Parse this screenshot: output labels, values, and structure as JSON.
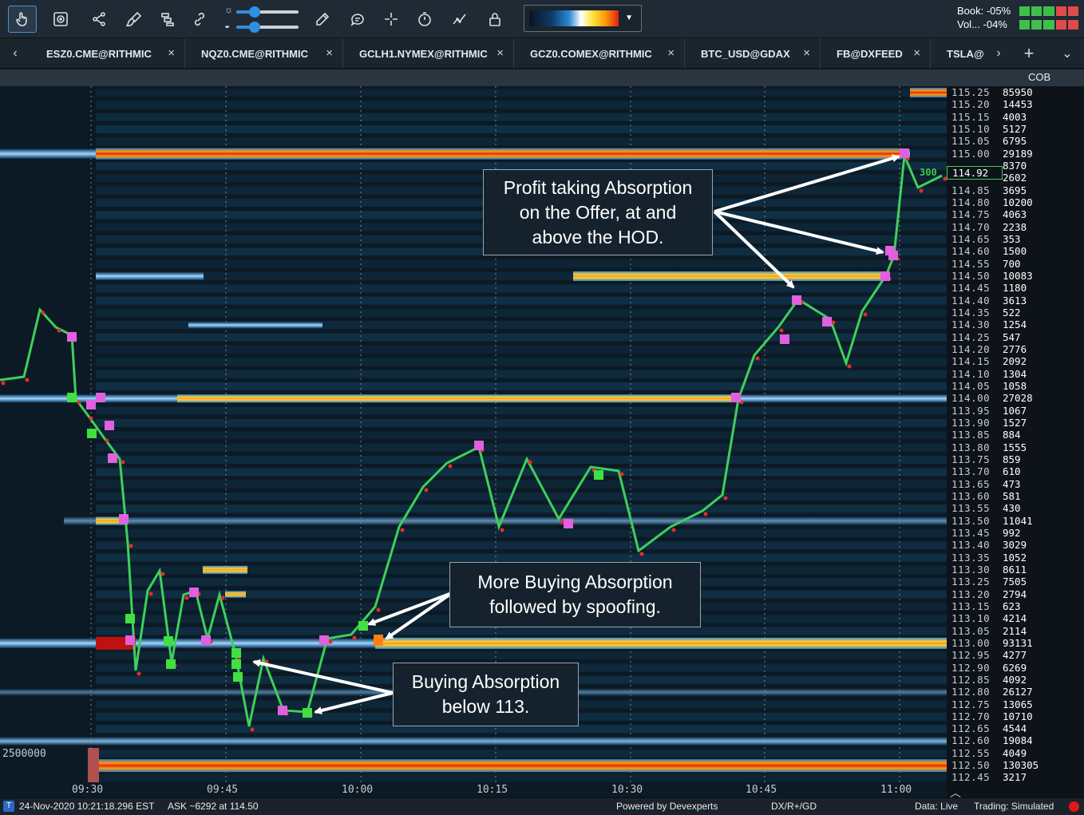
{
  "toolbar": {
    "buttons": [
      {
        "name": "pointer-tool",
        "icon": "hand-pointer-icon",
        "active": true
      },
      {
        "name": "zoom-tool",
        "icon": "zoom-box-icon"
      },
      {
        "name": "share-tool",
        "icon": "share-icon"
      },
      {
        "name": "brush-tool",
        "icon": "brush-icon"
      },
      {
        "name": "layers-tool",
        "icon": "layers-icon"
      },
      {
        "name": "link-tool",
        "icon": "link-icon"
      },
      {
        "name": "pencil-tool",
        "icon": "pencil-icon"
      },
      {
        "name": "comment-tool",
        "icon": "speech-bubble-icon"
      },
      {
        "name": "crosshair-tool",
        "icon": "crosshair-icon"
      },
      {
        "name": "timer-tool",
        "icon": "stopwatch-icon"
      },
      {
        "name": "indicator-tool",
        "icon": "line-chart-icon"
      },
      {
        "name": "lock-tool",
        "icon": "lock-icon"
      }
    ],
    "brightness_level": 0.3,
    "contrast_level": 0.3,
    "book_label": "Book: -05%",
    "vol_label": "Vol... -04%"
  },
  "tabs": [
    {
      "label": "ESZ0.CME@RITHMIC"
    },
    {
      "label": "NQZ0.CME@RITHMIC"
    },
    {
      "label": "GCLH1.NYMEX@RITHMIC"
    },
    {
      "label": "GCZ0.COMEX@RITHMIC"
    },
    {
      "label": "BTC_USD@GDAX"
    },
    {
      "label": "FB@DXFEED"
    },
    {
      "label": "TSLA@"
    }
  ],
  "chart": {
    "cob_label": "COB",
    "volume_label": "2500000",
    "last_price": "114.92",
    "last_size": "300",
    "time_ticks": [
      "09:30",
      "09:45",
      "10:00",
      "10:15",
      "10:30",
      "10:45",
      "11:00"
    ],
    "ladder": [
      {
        "price": "115.25",
        "vol": "85950"
      },
      {
        "price": "115.20",
        "vol": "14453"
      },
      {
        "price": "115.15",
        "vol": "4003"
      },
      {
        "price": "115.10",
        "vol": "5127"
      },
      {
        "price": "115.05",
        "vol": "6795"
      },
      {
        "price": "115.00",
        "vol": "29189"
      },
      {
        "price": "",
        "vol": "8370"
      },
      {
        "price": "",
        "vol": "2602"
      },
      {
        "price": "114.85",
        "vol": "3695"
      },
      {
        "price": "114.80",
        "vol": "10200"
      },
      {
        "price": "114.75",
        "vol": "4063"
      },
      {
        "price": "114.70",
        "vol": "2238"
      },
      {
        "price": "114.65",
        "vol": "353"
      },
      {
        "price": "114.60",
        "vol": "1500"
      },
      {
        "price": "114.55",
        "vol": "700"
      },
      {
        "price": "114.50",
        "vol": "10083"
      },
      {
        "price": "114.45",
        "vol": "1180"
      },
      {
        "price": "114.40",
        "vol": "3613"
      },
      {
        "price": "114.35",
        "vol": "522"
      },
      {
        "price": "114.30",
        "vol": "1254"
      },
      {
        "price": "114.25",
        "vol": "547"
      },
      {
        "price": "114.20",
        "vol": "2776"
      },
      {
        "price": "114.15",
        "vol": "2092"
      },
      {
        "price": "114.10",
        "vol": "1304"
      },
      {
        "price": "114.05",
        "vol": "1058"
      },
      {
        "price": "114.00",
        "vol": "27028"
      },
      {
        "price": "113.95",
        "vol": "1067"
      },
      {
        "price": "113.90",
        "vol": "1527"
      },
      {
        "price": "113.85",
        "vol": "884"
      },
      {
        "price": "113.80",
        "vol": "1555"
      },
      {
        "price": "113.75",
        "vol": "859"
      },
      {
        "price": "113.70",
        "vol": "610"
      },
      {
        "price": "113.65",
        "vol": "473"
      },
      {
        "price": "113.60",
        "vol": "581"
      },
      {
        "price": "113.55",
        "vol": "430"
      },
      {
        "price": "113.50",
        "vol": "11041"
      },
      {
        "price": "113.45",
        "vol": "992"
      },
      {
        "price": "113.40",
        "vol": "3029"
      },
      {
        "price": "113.35",
        "vol": "1052"
      },
      {
        "price": "113.30",
        "vol": "8611"
      },
      {
        "price": "113.25",
        "vol": "7505"
      },
      {
        "price": "113.20",
        "vol": "2794"
      },
      {
        "price": "113.15",
        "vol": "623"
      },
      {
        "price": "113.10",
        "vol": "4214"
      },
      {
        "price": "113.05",
        "vol": "2114"
      },
      {
        "price": "113.00",
        "vol": "93131"
      },
      {
        "price": "112.95",
        "vol": "4277"
      },
      {
        "price": "112.90",
        "vol": "6269"
      },
      {
        "price": "112.85",
        "vol": "4092"
      },
      {
        "price": "112.80",
        "vol": "26127"
      },
      {
        "price": "112.75",
        "vol": "13065"
      },
      {
        "price": "112.70",
        "vol": "10710"
      },
      {
        "price": "112.65",
        "vol": "4544"
      },
      {
        "price": "112.60",
        "vol": "19084"
      },
      {
        "price": "112.55",
        "vol": "4049"
      },
      {
        "price": "112.50",
        "vol": "130305"
      },
      {
        "price": "112.45",
        "vol": "3217"
      }
    ],
    "heat_levels": [
      {
        "price": 115.0,
        "intensity": "hot"
      },
      {
        "price": 114.5,
        "intensity": "warm"
      },
      {
        "price": 114.0,
        "intensity": "warm"
      },
      {
        "price": 113.5,
        "intensity": "mild"
      },
      {
        "price": 113.0,
        "intensity": "hot"
      },
      {
        "price": 112.5,
        "intensity": "hot"
      }
    ],
    "colors": {
      "up_tick": "#3fcf5a",
      "down_tick": "#e0302a",
      "absorption_buy": "#3fe040",
      "absorption_sell": "#e060e0",
      "annotation_arrow": "#ffffff"
    }
  },
  "annotations": [
    {
      "lines": [
        "Profit taking Absorption",
        "on the Offer, at and",
        "above the HOD."
      ]
    },
    {
      "lines": [
        "More Buying Absorption",
        "followed by spoofing."
      ]
    },
    {
      "lines": [
        "Buying Absorption",
        "below 113."
      ]
    }
  ],
  "status": {
    "datetime": "24-Nov-2020 10:21:18.296 EST",
    "ask": "ASK ~6292 at 114.50",
    "powered_by": "Powered by Devexperts",
    "feeds": "DX/R+/GD",
    "data": "Data: Live",
    "trading": "Trading: Simulated"
  }
}
